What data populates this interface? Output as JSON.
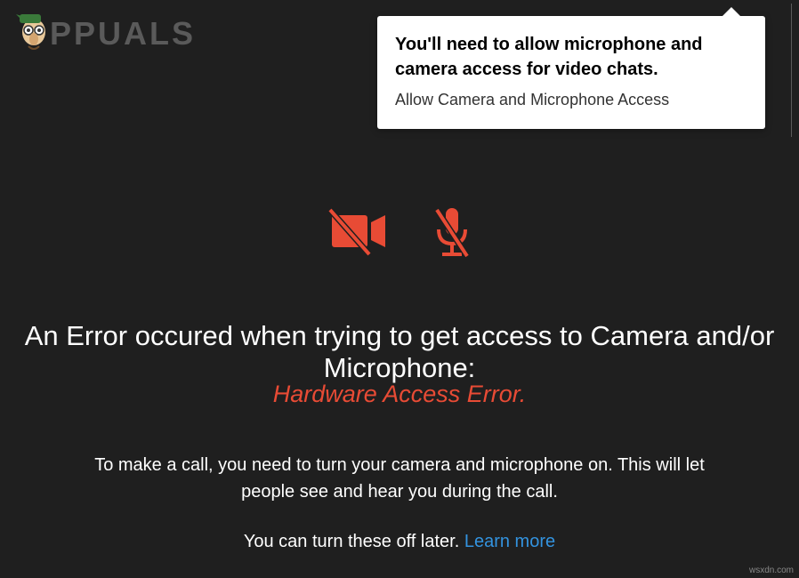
{
  "logo": {
    "text": "PPUALS"
  },
  "popover": {
    "title": "You'll need to allow microphone and camera access for video chats.",
    "subtitle": "Allow Camera and Microphone Access"
  },
  "error": {
    "heading": "An Error occured when trying to get access to Camera and/or Microphone:",
    "type": "Hardware Access Error."
  },
  "info": {
    "line": "To make a call, you need to turn your camera and microphone on. This will let people see and hear you during the call.",
    "later": "You can turn these off later. ",
    "learn_more": "Learn more"
  },
  "watermark": "wsxdn.com"
}
